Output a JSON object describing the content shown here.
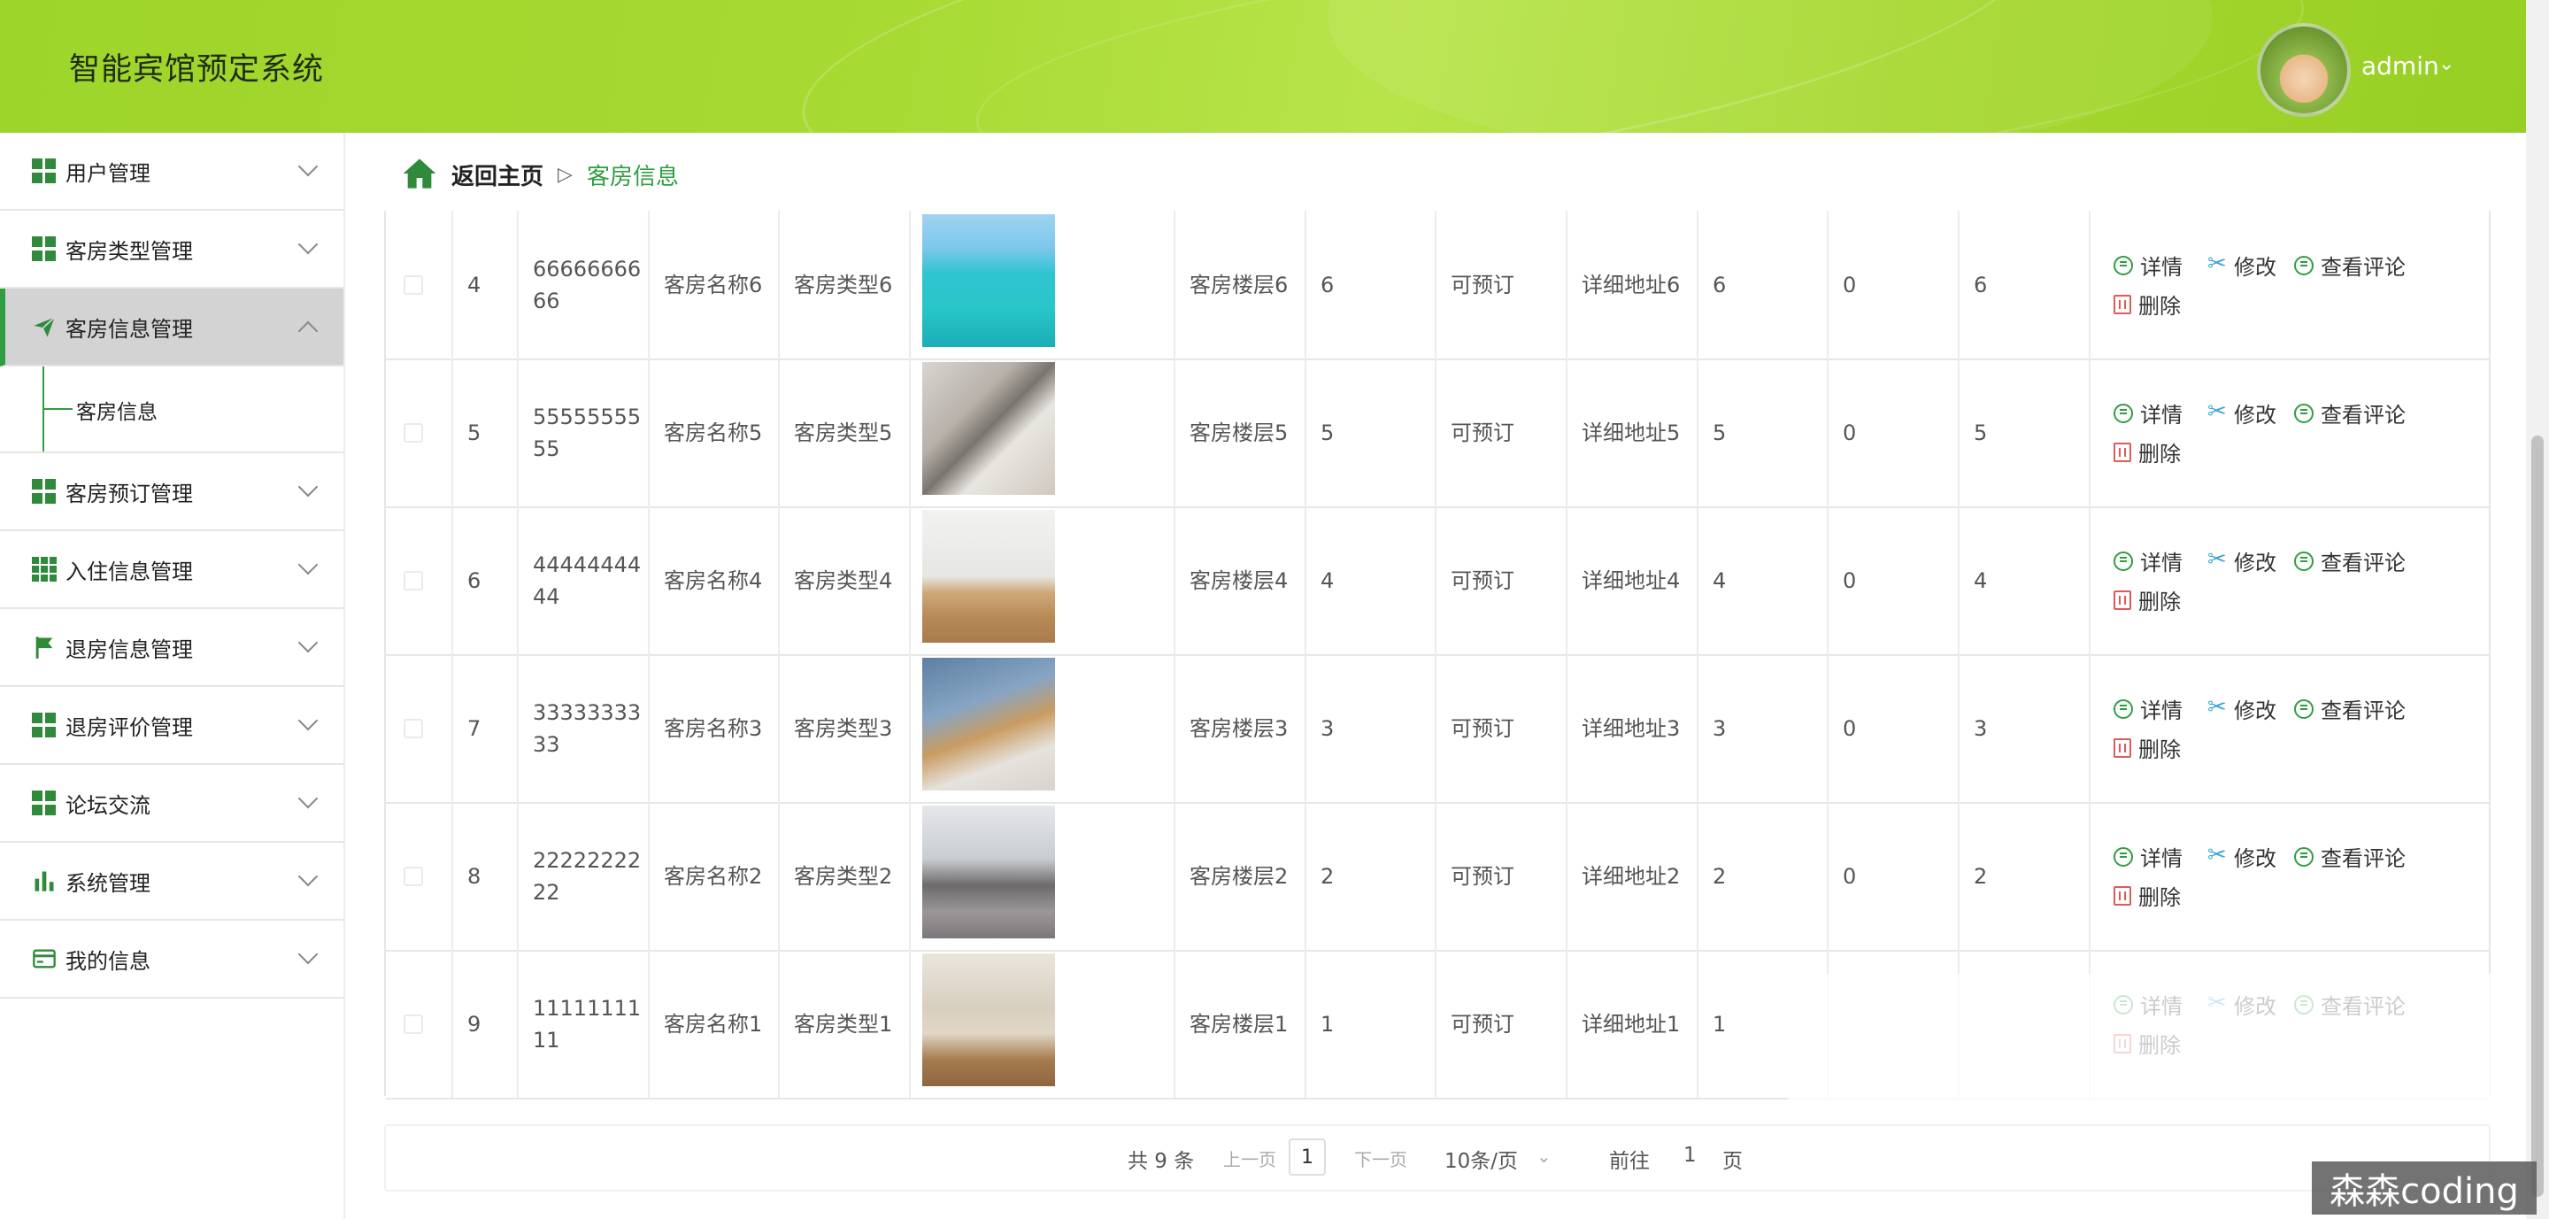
{
  "header": {
    "app_title": "智能宾馆预定系统",
    "user_name": "admin"
  },
  "sidebar": {
    "items": [
      {
        "label": "用户管理",
        "icon": "grid-icon"
      },
      {
        "label": "客房类型管理",
        "icon": "grid-icon"
      },
      {
        "label": "客房信息管理",
        "icon": "send-icon",
        "active": true,
        "children": [
          "客房信息"
        ]
      },
      {
        "label": "客房预订管理",
        "icon": "grid-icon"
      },
      {
        "label": "入住信息管理",
        "icon": "apps-icon"
      },
      {
        "label": "退房信息管理",
        "icon": "flag-icon"
      },
      {
        "label": "退房评价管理",
        "icon": "grid-icon"
      },
      {
        "label": "论坛交流",
        "icon": "grid-icon"
      },
      {
        "label": "系统管理",
        "icon": "bar-chart-icon"
      },
      {
        "label": "我的信息",
        "icon": "card-icon"
      }
    ]
  },
  "breadcrumb": {
    "home": "返回主页",
    "separator": "▷",
    "current": "客房信息"
  },
  "table": {
    "rows": [
      {
        "index": "4",
        "code": "6666666666",
        "name": "客房名称6",
        "type": "客房类型6",
        "floor": "客房楼层6",
        "num": "6",
        "status": "可预订",
        "address": "详细地址6",
        "a": "6",
        "b": "0",
        "c": "6"
      },
      {
        "index": "5",
        "code": "5555555555",
        "name": "客房名称5",
        "type": "客房类型5",
        "floor": "客房楼层5",
        "num": "5",
        "status": "可预订",
        "address": "详细地址5",
        "a": "5",
        "b": "0",
        "c": "5"
      },
      {
        "index": "6",
        "code": "4444444444",
        "name": "客房名称4",
        "type": "客房类型4",
        "floor": "客房楼层4",
        "num": "4",
        "status": "可预订",
        "address": "详细地址4",
        "a": "4",
        "b": "0",
        "c": "4"
      },
      {
        "index": "7",
        "code": "3333333333",
        "name": "客房名称3",
        "type": "客房类型3",
        "floor": "客房楼层3",
        "num": "3",
        "status": "可预订",
        "address": "详细地址3",
        "a": "3",
        "b": "0",
        "c": "3"
      },
      {
        "index": "8",
        "code": "2222222222",
        "name": "客房名称2",
        "type": "客房类型2",
        "floor": "客房楼层2",
        "num": "2",
        "status": "可预订",
        "address": "详细地址2",
        "a": "2",
        "b": "0",
        "c": "2"
      },
      {
        "index": "9",
        "code": "1111111111",
        "name": "客房名称1",
        "type": "客房类型1",
        "floor": "客房楼层1",
        "num": "1",
        "status": "可预订",
        "address": "详细地址1",
        "a": "1",
        "b": "",
        "c": ""
      }
    ],
    "actions": {
      "detail": "详情",
      "edit": "修改",
      "comments": "查看评论",
      "delete": "删除"
    }
  },
  "pagination": {
    "total": "共 9 条",
    "prev": "上一页",
    "page": "1",
    "next": "下一页",
    "page_size": "10条/页",
    "goto_prefix": "前往",
    "goto_value": "1",
    "goto_suffix": "页"
  },
  "watermark": "森森coding"
}
